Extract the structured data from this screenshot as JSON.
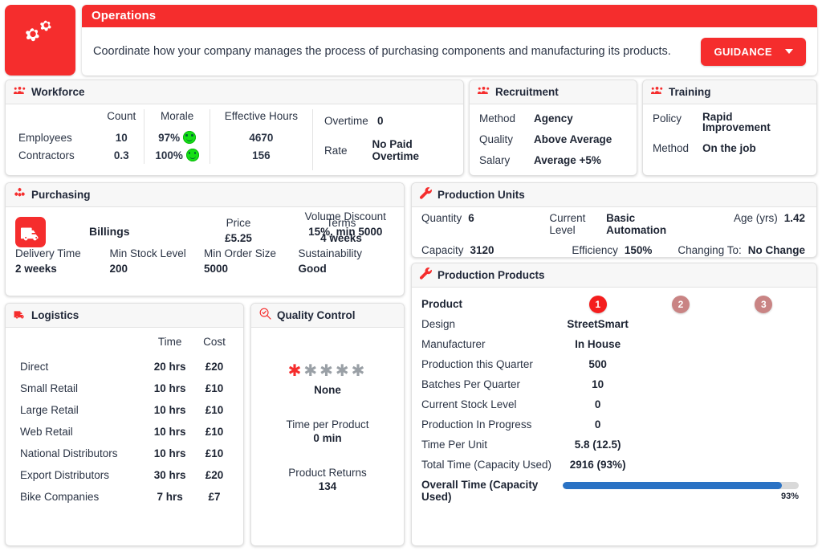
{
  "header": {
    "logo_icon": "cogs-icon",
    "title": "Operations",
    "description": "Coordinate how your company manages the process of purchasing components and manufacturing its products.",
    "guidance_label": "GUIDANCE"
  },
  "workforce": {
    "icon": "users-icon",
    "title": "Workforce",
    "columns": [
      "",
      "Count",
      "Morale",
      "Effective Hours"
    ],
    "rows": [
      {
        "name": "Employees",
        "count": "10",
        "morale": "97%",
        "hours": "4670"
      },
      {
        "name": "Contractors",
        "count": "0.3",
        "morale": "100%",
        "hours": "156"
      }
    ],
    "overtime_label": "Overtime",
    "overtime_value": "0",
    "rate_label": "Rate",
    "rate_value": "No Paid Overtime"
  },
  "recruitment": {
    "icon": "users-icon",
    "title": "Recruitment",
    "rows": [
      {
        "label": "Method",
        "value": "Agency"
      },
      {
        "label": "Quality",
        "value": "Above Average"
      },
      {
        "label": "Salary",
        "value": "Average +5%"
      }
    ]
  },
  "training": {
    "icon": "users-icon",
    "title": "Training",
    "rows": [
      {
        "label": "Policy",
        "value": "Rapid Improvement"
      },
      {
        "label": "Method",
        "value": "On the job"
      }
    ]
  },
  "purchasing": {
    "icon": "cubes-icon",
    "title": "Purchasing",
    "supplier_icon": "truck-icon",
    "supplier_name": "Billings",
    "cells_row1": [
      {
        "label": "Price",
        "value": "£5.25"
      },
      {
        "label": "Terms",
        "value": "4 weeks"
      },
      {
        "label": "Volume Discount",
        "value": "15%, min 5000"
      }
    ],
    "cells_row2": [
      {
        "label": "Delivery Time",
        "value": "2 weeks"
      },
      {
        "label": "Min Stock Level",
        "value": "200"
      },
      {
        "label": "Min Order Size",
        "value": "5000"
      },
      {
        "label": "Sustainability",
        "value": "Good"
      }
    ]
  },
  "production_units": {
    "icon": "wrench-icon",
    "title": "Production Units",
    "cells": [
      {
        "label": "Quantity",
        "value": "6"
      },
      {
        "label": "Current Level",
        "value": "Basic Automation"
      },
      {
        "label": "Age (yrs)",
        "value": "1.42"
      },
      {
        "label": "Capacity",
        "value": "3120"
      },
      {
        "label": "Efficiency",
        "value": "150%"
      },
      {
        "label": "Changing To:",
        "value": "No Change"
      }
    ]
  },
  "production_products": {
    "icon": "wrench-icon",
    "title": "Production Products",
    "product_label": "Product",
    "product_badges": [
      {
        "num": "1",
        "active": true
      },
      {
        "num": "2",
        "active": false
      },
      {
        "num": "3",
        "active": false
      }
    ],
    "rows": [
      {
        "label": "Design",
        "values": [
          "StreetSmart",
          "",
          ""
        ]
      },
      {
        "label": "Manufacturer",
        "values": [
          "In House",
          "",
          ""
        ]
      },
      {
        "label": "Production this Quarter",
        "values": [
          "500",
          "",
          ""
        ]
      },
      {
        "label": "Batches Per Quarter",
        "values": [
          "10",
          "",
          ""
        ]
      },
      {
        "label": "Current Stock Level",
        "values": [
          "0",
          "",
          ""
        ]
      },
      {
        "label": "Production In Progress",
        "values": [
          "0",
          "",
          ""
        ]
      },
      {
        "label": "Time Per Unit",
        "values": [
          "5.8 (12.5)",
          "",
          ""
        ]
      },
      {
        "label": "Total Time (Capacity Used)",
        "values": [
          "2916 (93%)",
          "",
          ""
        ]
      }
    ],
    "overall_label": "Overall Time (Capacity Used)",
    "overall_percent": 93,
    "overall_percent_text": "93%"
  },
  "logistics": {
    "icon": "truck-icon",
    "title": "Logistics",
    "columns": [
      "",
      "Time",
      "Cost"
    ],
    "rows": [
      {
        "channel": "Direct",
        "time": "20 hrs",
        "cost": "£20"
      },
      {
        "channel": "Small Retail",
        "time": "10 hrs",
        "cost": "£10"
      },
      {
        "channel": "Large Retail",
        "time": "10 hrs",
        "cost": "£10"
      },
      {
        "channel": "Web Retail",
        "time": "10 hrs",
        "cost": "£10"
      },
      {
        "channel": "National Distributors",
        "time": "10 hrs",
        "cost": "£10"
      },
      {
        "channel": "Export Distributors",
        "time": "30 hrs",
        "cost": "£20"
      },
      {
        "channel": "Bike Companies",
        "time": "7 hrs",
        "cost": "£7"
      }
    ]
  },
  "quality_control": {
    "icon": "search-check-icon",
    "title": "Quality Control",
    "rating_filled": 1,
    "rating_total": 5,
    "rating_label": "None",
    "time_label": "Time per Product",
    "time_value": "0 min",
    "returns_label": "Product Returns",
    "returns_value": "134"
  },
  "colors": {
    "brand_red": "#f52d2d",
    "progress_blue": "#2a72c4",
    "badge_inactive": "#c98484",
    "morale_green": "#15e015"
  }
}
